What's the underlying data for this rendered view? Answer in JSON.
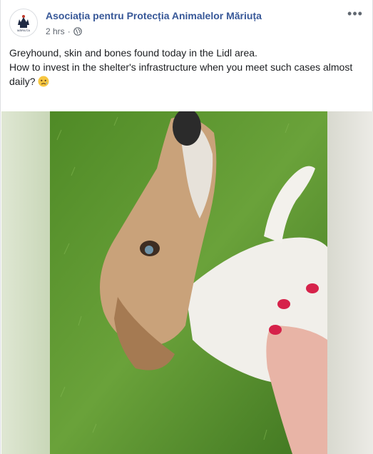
{
  "post": {
    "page_name": "Asociația pentru Protecția Animalelor Măriuța",
    "time": "2 hrs",
    "separator": "·",
    "more_label": "•••",
    "text_line1": "Greyhound, skin and bones found today in the Lidl area.",
    "text_line2": "How to invest in the shelter's infrastructure when you meet such cases almost daily?",
    "emoji": "sad-relieved-face",
    "privacy_icon": "globe-icon"
  },
  "avatar": {
    "logo_text": "MĂRIUȚA"
  },
  "colors": {
    "link": "#385898",
    "meta": "#606770",
    "text": "#1c1e21",
    "grass": "#5c8f2e"
  }
}
